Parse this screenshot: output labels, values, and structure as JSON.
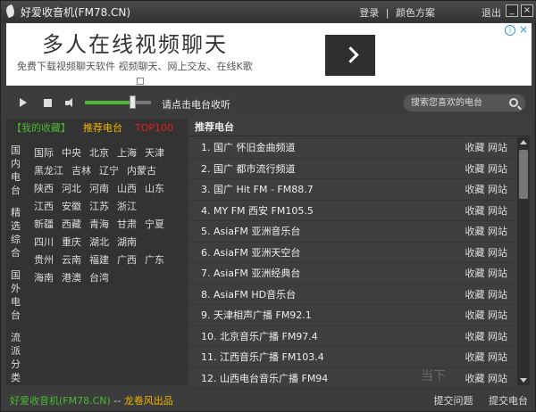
{
  "app": {
    "title": "好爱收音机(FM78.CN)"
  },
  "topbar": {
    "login": "登录",
    "sep": "|",
    "theme": "颜色方案",
    "exit": "退出",
    "minimize": "_",
    "close": "×"
  },
  "ad": {
    "title": "多人在线视频聊天",
    "subtitle": "免费下载视频聊天软件 视频聊天、网上交友、在线K歌",
    "info": "i",
    "close": "×"
  },
  "player": {
    "status": "请点击电台收听",
    "volume": 0.75,
    "search_placeholder": "搜索您喜欢的电台"
  },
  "left": {
    "tabs": {
      "fav": "【我的收藏】",
      "recommended": "推荐电台",
      "top": "TOP100"
    },
    "categories": [
      "国内电台",
      "精选综合",
      "国外电台",
      "流派分类"
    ],
    "regions": [
      [
        "国际",
        "中央",
        "北京",
        "上海",
        "天津"
      ],
      [
        "黑龙江",
        "吉林",
        "辽宁",
        "内蒙古"
      ],
      [
        "陕西",
        "河北",
        "河南",
        "山西",
        "山东"
      ],
      [
        "江西",
        "安徽",
        "江苏",
        "浙江"
      ],
      [
        "新疆",
        "西藏",
        "青海",
        "甘肃",
        "宁夏"
      ],
      [
        "四川",
        "重庆",
        "湖北",
        "湖南"
      ],
      [
        "贵州",
        "云南",
        "福建",
        "广西",
        "广东"
      ],
      [
        "海南",
        "港澳",
        "台湾"
      ]
    ]
  },
  "right": {
    "header": "推荐电台",
    "fav_label": "收藏",
    "site_label": "网站",
    "stations": [
      "1. 国广 怀旧金曲频道",
      "2. 国广 都市流行频道",
      "3. 国广 Hit FM - FM88.7",
      "4. MY FM 西安 FM105.5",
      "5. AsiaFM 亚洲音乐台",
      "6. AsiaFM 亚洲天空台",
      "7. AsiaFM 亚洲经典台",
      "8. AsiaFM HD音乐台",
      "9. 天津相声广播 FM92.1",
      "10. 北京音乐广播 FM97.4",
      "11. 江西音乐广播 FM103.4",
      "12. 山西电台音乐广播 FM94"
    ]
  },
  "footer": {
    "left_app": "好爱收音机(FM78.CN)",
    "sep": " -- ",
    "left_credit": "龙卷风出品",
    "feedback": "提交问题",
    "submit": "提交电台"
  },
  "watermark": "当下"
}
